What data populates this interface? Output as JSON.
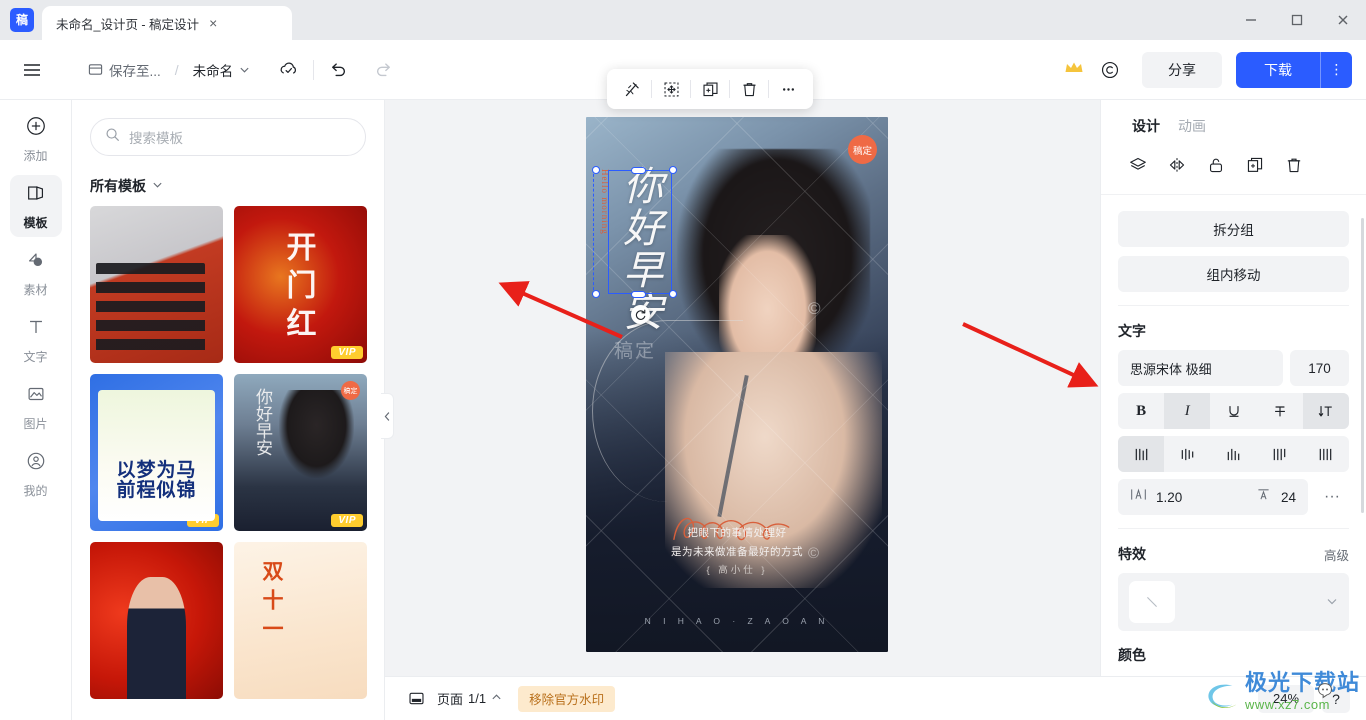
{
  "titlebar": {
    "logo_text": "稿",
    "tab_title": "未命名_设计页 - 稿定设计",
    "close_label": "×",
    "window_controls": [
      "minimize",
      "maximize",
      "close"
    ]
  },
  "header": {
    "menu_icon": "hamburger-icon",
    "save_to_label": "保存至...",
    "separator": "/",
    "doc_name": "未命名",
    "cloud_icon": "cloud-sync-icon",
    "undo_icon": "undo-icon",
    "redo_icon": "redo-icon",
    "crown_icon": "crown-icon",
    "copyright_icon": "copyright-icon",
    "share_label": "分享",
    "download_label": "下载",
    "download_more": "⋮"
  },
  "rail": {
    "items": [
      {
        "label": "添加",
        "icon": "plus-circle-icon",
        "active": false
      },
      {
        "label": "模板",
        "icon": "template-icon",
        "active": true
      },
      {
        "label": "素材",
        "icon": "shape-icon",
        "active": false
      },
      {
        "label": "文字",
        "icon": "text-icon",
        "active": false
      },
      {
        "label": "图片",
        "icon": "image-icon",
        "active": false
      },
      {
        "label": "我的",
        "icon": "user-icon",
        "active": false
      }
    ]
  },
  "panel": {
    "search_placeholder": "搜索模板",
    "search_icon": "search-icon",
    "category_title": "所有模板",
    "category_caret": "chevron-down-icon",
    "templates": [
      {
        "id": "t1",
        "vip": false,
        "text": ""
      },
      {
        "id": "t2",
        "vip": true,
        "text": "开门红"
      },
      {
        "id": "t3",
        "vip": true,
        "text": "以梦为马\n前程似锦"
      },
      {
        "id": "t4",
        "vip": true,
        "text": "你好早安"
      },
      {
        "id": "t5",
        "vip": false,
        "text": ""
      },
      {
        "id": "t6",
        "vip": false,
        "text": "双十一课程钜惠"
      }
    ],
    "vip_badge": "VIP",
    "collapse_icon": "chevron-left-icon"
  },
  "canvas": {
    "object_toolbar": [
      {
        "name": "crop-magic-icon",
        "label": "抠图"
      },
      {
        "name": "move-select-icon",
        "label": "选区移动"
      },
      {
        "name": "duplicate-icon",
        "label": "复制"
      },
      {
        "name": "delete-icon",
        "label": "删除"
      },
      {
        "name": "more-icon",
        "label": "..."
      }
    ],
    "badge_text": "稿定",
    "poster": {
      "title": "你好早安",
      "subtitle_en": "Hello morning",
      "quote_line1": "把眼下的事情处理好",
      "quote_line2": "是为未来做准备最好的方式",
      "author": "{ 高小仕 }",
      "pinyin": "N I H A O  ·  Z A O A N",
      "watermark_text": "稿定",
      "watermark_c": "©"
    },
    "rotate_icon": "rotate-icon"
  },
  "right": {
    "tabs": [
      {
        "label": "设计",
        "active": true
      },
      {
        "label": "动画",
        "active": false
      }
    ],
    "icons": [
      {
        "name": "layers-icon",
        "label": "图层"
      },
      {
        "name": "flip-icon",
        "label": "翻转"
      },
      {
        "name": "unlock-icon",
        "label": "解锁"
      },
      {
        "name": "copy-icon",
        "label": "复制"
      },
      {
        "name": "trash-icon",
        "label": "删除"
      }
    ],
    "ungroup_label": "拆分组",
    "move_in_group_label": "组内移动",
    "text_section_title": "文字",
    "font_name": "思源宋体 极细",
    "font_size": "170",
    "style_buttons": [
      {
        "name": "bold-button",
        "glyph": "B",
        "on": false
      },
      {
        "name": "italic-button",
        "glyph": "I",
        "on": true
      },
      {
        "name": "underline-button",
        "glyph": "U",
        "on": false
      },
      {
        "name": "strikethrough-button",
        "glyph": "T",
        "on": false
      },
      {
        "name": "vertical-text-button",
        "glyph": "↓T",
        "on": true
      }
    ],
    "align_buttons": [
      {
        "name": "align-justify-button",
        "on": true
      },
      {
        "name": "align-center-button",
        "on": false
      },
      {
        "name": "align-bottom-button",
        "on": false
      },
      {
        "name": "align-left-button",
        "on": false
      },
      {
        "name": "align-right-button",
        "on": false
      }
    ],
    "line_height_icon": "line-height-icon",
    "line_height_value": "1.20",
    "letter_spacing_icon": "letter-spacing-icon",
    "letter_spacing_value": "24",
    "more_dots": "···",
    "fx_section_title": "特效",
    "fx_advanced_label": "高级",
    "fx_caret": "chevron-down-icon",
    "color_section_title": "颜色"
  },
  "bottom": {
    "pages_icon": "pages-icon",
    "page_label": "页面",
    "page_value": "1/1",
    "page_caret": "chevron-up-icon",
    "remove_watermark_label": "移除官方水印",
    "zoom_value": "24%",
    "help_label": "?"
  },
  "site_watermark": {
    "cn": "极光下载站",
    "url": "www.xz7.com"
  }
}
